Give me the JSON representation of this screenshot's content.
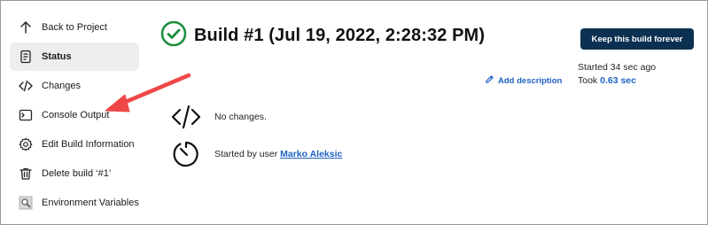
{
  "sidebar": {
    "items": [
      {
        "label": "Back to Project",
        "icon": "arrow-up-icon"
      },
      {
        "label": "Status",
        "icon": "document-icon",
        "active": true
      },
      {
        "label": "Changes",
        "icon": "code-icon"
      },
      {
        "label": "Console Output",
        "icon": "terminal-icon"
      },
      {
        "label": "Edit Build Information",
        "icon": "gear-icon"
      },
      {
        "label": "Delete build ‘#1’",
        "icon": "trash-icon"
      },
      {
        "label": "Environment Variables",
        "icon": "magnifier-icon"
      }
    ]
  },
  "build": {
    "title": "Build #1 (Jul 19, 2022, 2:28:32 PM)",
    "status_icon": "success-check-icon",
    "status_color": "#1e8f3e"
  },
  "actions": {
    "keep_label": "Keep this build forever",
    "add_description_label": "Add description"
  },
  "timing": {
    "started": "Started 34 sec ago",
    "took_prefix": "Took ",
    "took_value": "0.63 sec"
  },
  "details": {
    "changes_text": "No changes.",
    "started_by_prefix": "Started by user ",
    "started_by_user": "Marko Aleksic"
  },
  "annotation": {
    "arrow_color": "#ef4747"
  }
}
